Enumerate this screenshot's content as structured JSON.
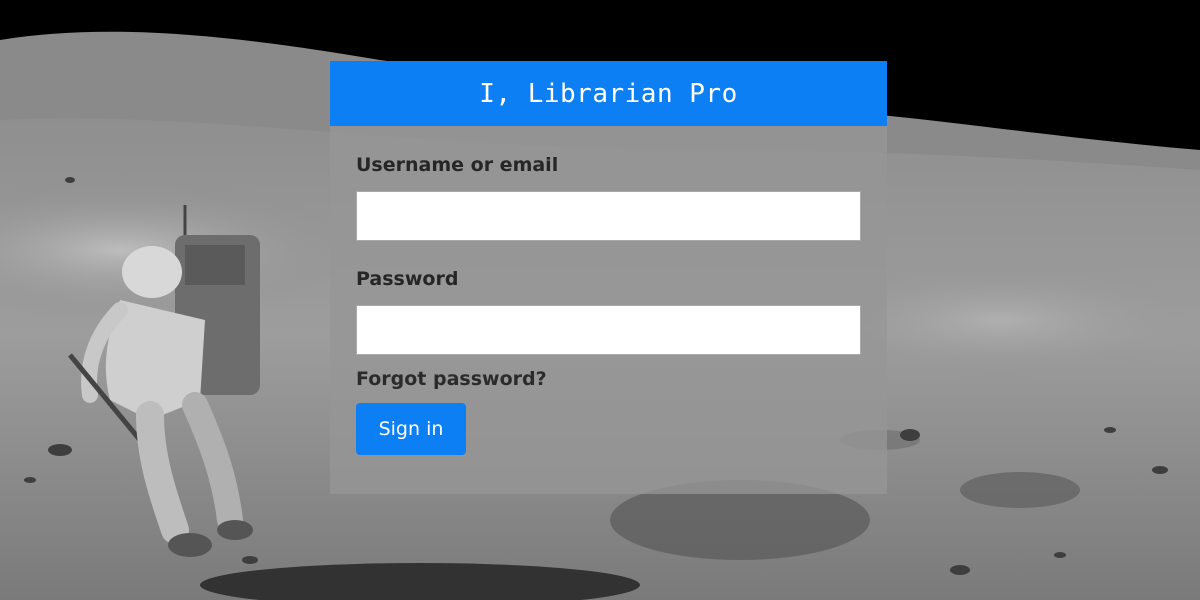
{
  "app": {
    "title": "I, Librarian Pro"
  },
  "login_form": {
    "username_label": "Username or email",
    "username_value": "",
    "password_label": "Password",
    "password_value": "",
    "forgot_password": "Forgot password?",
    "sign_in_label": "Sign in"
  },
  "colors": {
    "accent": "#0d7ff5",
    "panel_background": "#969696",
    "label_text": "#262626"
  }
}
